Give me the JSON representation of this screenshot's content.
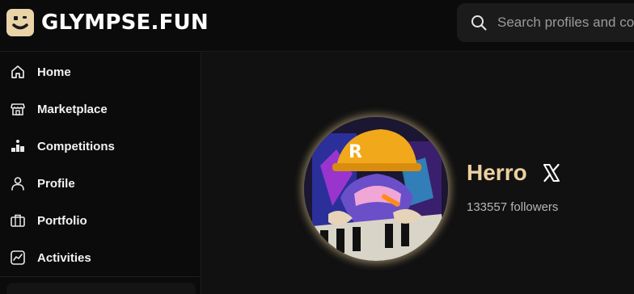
{
  "brand": {
    "name": "GLYMPSE.FUN",
    "logo_icon": "smile-face-icon",
    "accent": "#e9d3a7"
  },
  "search": {
    "placeholder": "Search profiles and con",
    "icon": "search-icon"
  },
  "sidebar": {
    "items": [
      {
        "label": "Home",
        "icon": "home-icon"
      },
      {
        "label": "Marketplace",
        "icon": "store-icon"
      },
      {
        "label": "Competitions",
        "icon": "podium-icon"
      },
      {
        "label": "Profile",
        "icon": "user-icon"
      },
      {
        "label": "Portfolio",
        "icon": "briefcase-icon"
      },
      {
        "label": "Activities",
        "icon": "chart-icon"
      }
    ]
  },
  "profile": {
    "name": "Herro",
    "followers_text": "133557 followers",
    "social_icon": "x-logo-icon",
    "name_color": "#ecd09f"
  }
}
